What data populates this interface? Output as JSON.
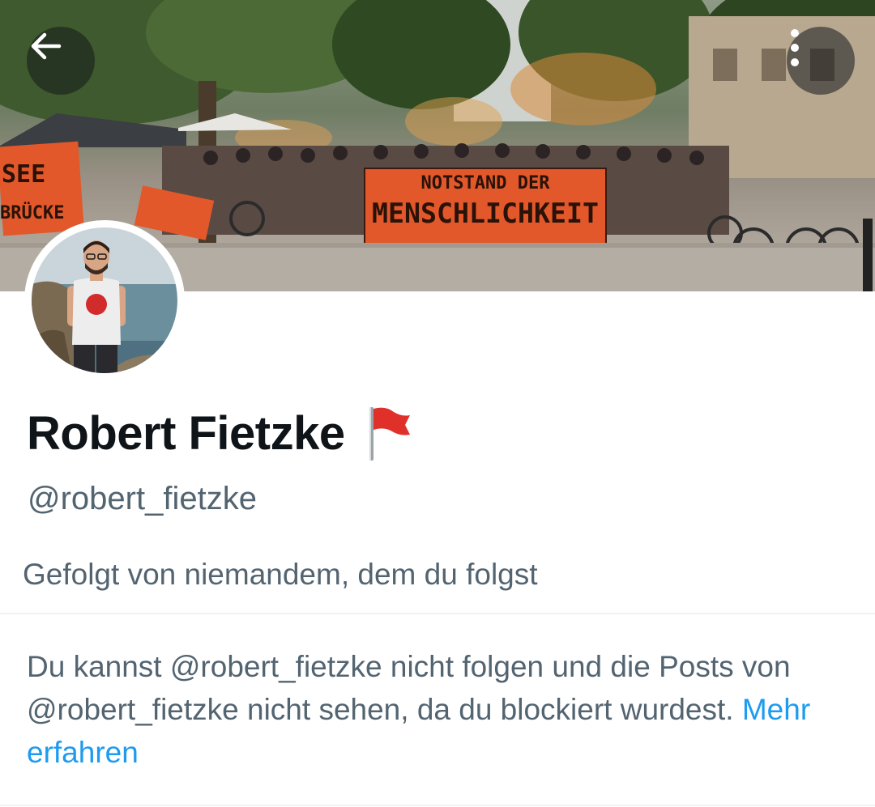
{
  "header": {
    "back_icon": "arrow-left-icon",
    "more_icon": "more-vertical-icon",
    "banner": {
      "sign_left": [
        "SEE",
        "BRÜCKE"
      ],
      "banner_line1": "NOTSTAND DER",
      "banner_line2": "MENSCHLICHKEIT"
    }
  },
  "profile": {
    "display_name": "Robert Fietzke",
    "name_badge_icon": "red-flag-icon",
    "handle": "@robert_fietzke",
    "followed_by": "Gefolgt von niemandem, dem du folgst"
  },
  "blocked_notice": {
    "text": "Du kannst @robert_fietzke nicht folgen und die Posts von @robert_fietzke nicht sehen, da du blockiert wurdest.",
    "link_label": "Mehr erfahren"
  },
  "colors": {
    "primary_text": "#0f1419",
    "secondary_text": "#536471",
    "link": "#1d9bf0",
    "divider": "#eff3f4",
    "banner_orange": "#e2582a"
  }
}
